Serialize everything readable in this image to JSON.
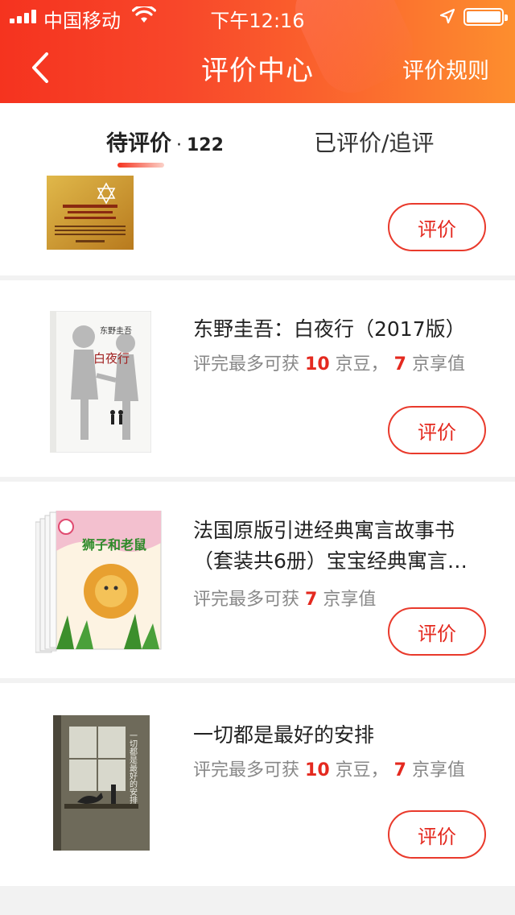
{
  "status_bar": {
    "carrier": "中国移动",
    "time": "下午12:16"
  },
  "nav": {
    "title": "评价中心",
    "rules_link": "评价规则"
  },
  "tabs": {
    "pending_label": "待评价",
    "pending_separator": "·",
    "pending_count": "122",
    "reviewed_label": "已评价/追评"
  },
  "products": [
    {
      "title": "",
      "button": "评价"
    },
    {
      "title": "东野圭吾：白夜行（2017版）",
      "reward_prefix": "评完最多可获",
      "beans": "10",
      "beans_unit": "京豆，",
      "credit": "7",
      "credit_unit": "京享值",
      "button": "评价",
      "cover_text_author": "东野圭吾",
      "cover_text_title": "白夜行"
    },
    {
      "title": "法国原版引进经典寓言故事书（套装共6册）宝宝经典寓言…",
      "reward_prefix": "评完最多可获",
      "credit": "7",
      "credit_unit": "京享值",
      "button": "评价",
      "cover_text_title": "狮子和老鼠"
    },
    {
      "title": "一切都是最好的安排",
      "reward_prefix": "评完最多可获",
      "beans": "10",
      "beans_unit": "京豆，",
      "credit": "7",
      "credit_unit": "京享值",
      "button": "评价",
      "cover_text_title": "一切都是最好的安排"
    }
  ],
  "colors": {
    "accent": "#e4291f",
    "header_start": "#f5331f",
    "header_end": "#fd8e2e"
  }
}
